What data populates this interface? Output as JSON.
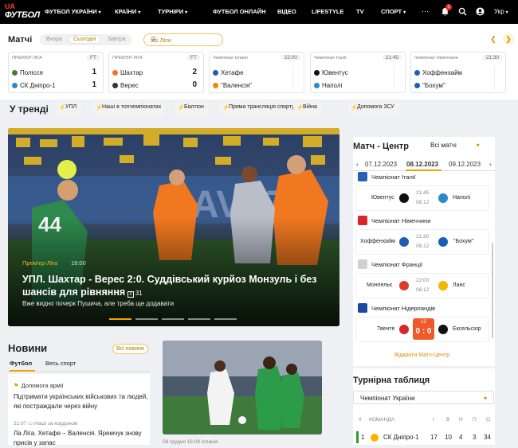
{
  "header": {
    "logo_ua": "UA",
    "logo_main": "ФУТБОЛ",
    "nav": [
      "ФУТБОЛ УКРАЇНИ",
      "КРАЇНИ",
      "ТУРНІРИ",
      "ФУТБОЛ ОНЛАЙН",
      "ВІДЕО",
      "LIFESTYLE",
      "TV",
      "СПОРТ"
    ],
    "notifications_count": "1",
    "language": "Укр"
  },
  "matches": {
    "title": "Матчі",
    "days": [
      "Вчора",
      "Сьогодні",
      "Завтра"
    ],
    "league_filter": "Усі Ліги",
    "cards": [
      {
        "league": "ПРЕМ'ЄР-ЛІГА",
        "status": "FT",
        "home": "Полісся",
        "away": "СК Дніпро-1",
        "hs": "1",
        "as": "1"
      },
      {
        "league": "ПРЕМ'ЄР-ЛІГА",
        "status": "FT",
        "home": "Шахтар",
        "away": "Верес",
        "hs": "2",
        "as": "0"
      },
      {
        "league": "Чемпіонат Іспанії",
        "status": "22:00",
        "home": "Хетафе",
        "away": "\"Валенсія\"",
        "hs": "",
        "as": ""
      },
      {
        "league": "Чемпіонат Італії",
        "status": "21:45",
        "home": "Ювентус",
        "away": "Наполі",
        "hs": "",
        "as": ""
      },
      {
        "league": "Чемпіонат Німеччини",
        "status": "21:30",
        "home": "Хоффенхайм",
        "away": "\"Бохум\"",
        "hs": "",
        "as": ""
      }
    ]
  },
  "trends": {
    "title": "У тренді",
    "chips": [
      "УПЛ",
      "Наші в топчемпіонатах",
      "Біатлон",
      "Пряма трансляція спорту",
      "Війна",
      "Допомога ЗСУ"
    ]
  },
  "hero": {
    "tag": "Прем'єр-Ліга",
    "time": "19:00",
    "title": "УПЛ. Шахтар - Верес 2:0. Суддівський курйоз Монзуль і без шансів для рівняння",
    "count": "31",
    "subtitle": "Вже видно почерк Пушича, але треба ще додавати",
    "slides": 5,
    "active_slide": 0,
    "shirt_text": "44"
  },
  "news": {
    "title": "Новини",
    "all_label": "Всі новини",
    "tabs": [
      "Футбол",
      "Весь спорт"
    ],
    "items": [
      {
        "category": "Допомога армії",
        "headline": "Підтримати українських військових та людей, які постраждали через війну"
      },
      {
        "time": "21:07",
        "category": "Наші за кордоном",
        "headline": "Ла Ліга. Хетафе – Валенсія. Яремчук знову присів у запас"
      }
    ],
    "photo_caption": "08 грудня 16:08  Іспанія"
  },
  "match_center": {
    "title": "Матч - Центр",
    "filter": "Всі матчі",
    "dates": [
      "07.12.2023",
      "08.12.2023",
      "09.12.2023"
    ],
    "active_date": 1,
    "groups": [
      {
        "league": "Чемпіонат Італії",
        "home": "Ювентус",
        "away": "Наполі",
        "time": "21:45",
        "date": "08.12"
      },
      {
        "league": "Чемпіонат Німеччини",
        "home": "Хоффенхайм",
        "away": "\"Бохум\"",
        "time": "21:30",
        "date": "08.12"
      },
      {
        "league": "Чемпіонат Франції",
        "home": "Монпельє",
        "away": "Ланс",
        "time": "22:00",
        "date": "08.12"
      },
      {
        "league": "Чемпіонат Нідерландів",
        "home": "Твенте",
        "away": "Ексельсіор",
        "live_minute": "12",
        "score": "0 : 0"
      }
    ],
    "open_label": "Відкрити Матч-Центр"
  },
  "table": {
    "title": "Турнірна таблиця",
    "select": "Чемпіонат України",
    "headers": [
      "#",
      "КОМАНДА",
      "І",
      "В",
      "Н",
      "П",
      "О"
    ],
    "rows": [
      {
        "pos": "1",
        "team": "СК Дніпро-1",
        "p": "17",
        "w": "10",
        "d": "4",
        "l": "3",
        "pts": "34"
      }
    ]
  },
  "colors": {
    "accent": "#f5a200",
    "brand_red": "#ff3b2f",
    "live": "#f05a2a"
  }
}
